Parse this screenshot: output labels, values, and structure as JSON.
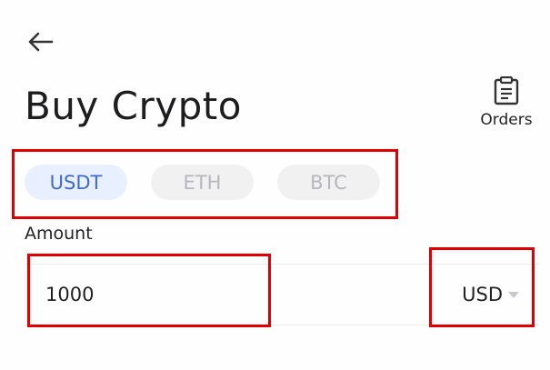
{
  "header": {
    "title": "Buy Crypto",
    "orders_label": "Orders"
  },
  "crypto_tabs": [
    {
      "label": "USDT",
      "selected": true
    },
    {
      "label": "ETH",
      "selected": false
    },
    {
      "label": "BTC",
      "selected": false
    }
  ],
  "amount": {
    "label": "Amount",
    "value": "1000",
    "currency": "USD"
  },
  "colors": {
    "active_chip_bg": "#e8efff",
    "active_chip_text": "#3f6ad0",
    "inactive_chip_bg": "#f1f1f2",
    "inactive_chip_text": "#b7b7bb",
    "highlight": "#e10000"
  },
  "icons": {
    "back": "arrow-left-icon",
    "orders": "clipboard-icon",
    "dropdown": "caret-down-icon"
  }
}
